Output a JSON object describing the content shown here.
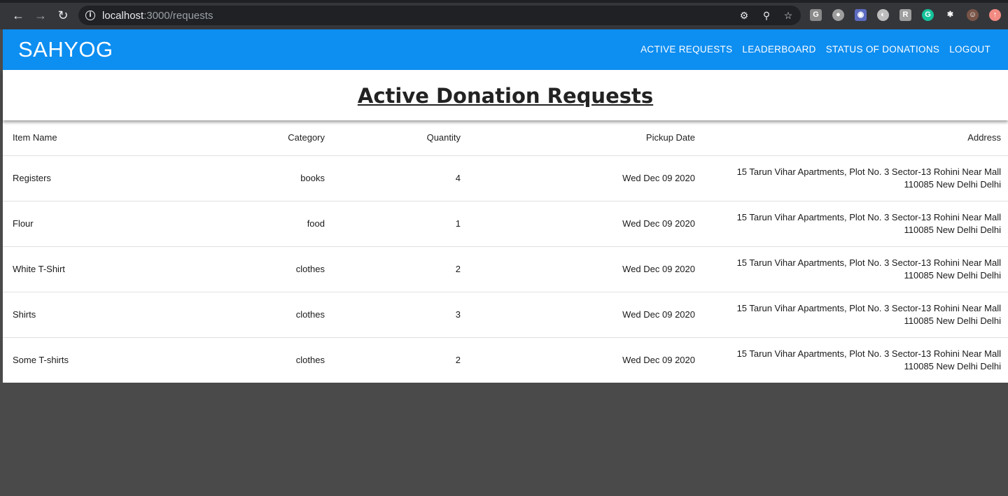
{
  "browser": {
    "url_host": "localhost",
    "url_path": ":3000/requests",
    "extensions": [
      {
        "name": "g-extension-icon",
        "label": "G",
        "color": "#8a8a8a"
      },
      {
        "name": "circle-extension-icon",
        "label": "●",
        "color": "#9e9e9e"
      },
      {
        "name": "camera-extension-icon",
        "label": "◉",
        "color": "#5c6bc0"
      },
      {
        "name": "clock-extension-icon",
        "label": "◐",
        "color": "#bdbdbd"
      },
      {
        "name": "r-extension-icon",
        "label": "R",
        "color": "#9e9e9e"
      },
      {
        "name": "grammarly-extension-icon",
        "label": "G",
        "color": "#15c39a"
      },
      {
        "name": "puzzle-extensions-icon",
        "label": "✱",
        "color": "transparent"
      },
      {
        "name": "profile-avatar-icon",
        "label": "☺",
        "color": "#795548"
      },
      {
        "name": "update-icon",
        "label": "↑",
        "color": "#f28b82"
      }
    ]
  },
  "app": {
    "brand": "SAHYOG",
    "brand_color": "#0d8ef1",
    "nav": {
      "active_requests": "ACTIVE REQUESTS",
      "leaderboard": "LEADERBOARD",
      "status_of_donations": "STATUS OF DONATIONS",
      "logout": "LOGOUT"
    }
  },
  "page": {
    "title": "Active Donation Requests"
  },
  "table": {
    "headers": {
      "item_name": "Item Name",
      "category": "Category",
      "quantity": "Quantity",
      "pickup_date": "Pickup Date",
      "address": "Address"
    },
    "rows": [
      {
        "item": "Registers",
        "category": "books",
        "quantity": "4",
        "date": "Wed Dec 09 2020",
        "address_line1": "15 Tarun Vihar Apartments, Plot No. 3 Sector-13 Rohini Near Mall",
        "address_line2": "110085 New Delhi Delhi"
      },
      {
        "item": "Flour",
        "category": "food",
        "quantity": "1",
        "date": "Wed Dec 09 2020",
        "address_line1": "15 Tarun Vihar Apartments, Plot No. 3 Sector-13 Rohini Near Mall",
        "address_line2": "110085 New Delhi Delhi"
      },
      {
        "item": "White T-Shirt",
        "category": "clothes",
        "quantity": "2",
        "date": "Wed Dec 09 2020",
        "address_line1": "15 Tarun Vihar Apartments, Plot No. 3 Sector-13 Rohini Near Mall",
        "address_line2": "110085 New Delhi Delhi"
      },
      {
        "item": "Shirts",
        "category": "clothes",
        "quantity": "3",
        "date": "Wed Dec 09 2020",
        "address_line1": "15 Tarun Vihar Apartments, Plot No. 3 Sector-13 Rohini Near Mall",
        "address_line2": "110085 New Delhi Delhi"
      },
      {
        "item": "Some T-shirts",
        "category": "clothes",
        "quantity": "2",
        "date": "Wed Dec 09 2020",
        "address_line1": "15 Tarun Vihar Apartments, Plot No. 3 Sector-13 Rohini Near Mall",
        "address_line2": "110085 New Delhi Delhi"
      }
    ]
  }
}
